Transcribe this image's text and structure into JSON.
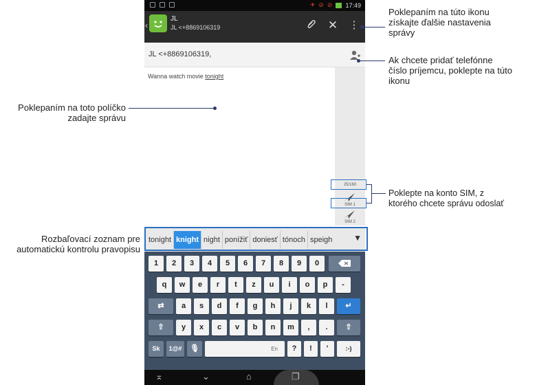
{
  "status_bar": {
    "time": "17:49"
  },
  "action_bar": {
    "name": "JL",
    "number": "JL <+8869106319",
    "attach_icon": "paperclip-icon",
    "discard_icon": "close-icon",
    "menu_icon": "overflow-menu-icon"
  },
  "recipient": {
    "value": "JL <+8869106319,"
  },
  "compose": {
    "text_before": "Wanna watch movie ",
    "text_underlined": "tonight"
  },
  "send_column": {
    "char_count": "25/160",
    "sim1_label": "SIM 1",
    "sim2_label": "SIM 2"
  },
  "suggestions": {
    "items": [
      "tonight",
      "knight",
      "night",
      "ponížiť",
      "doniesť",
      "tónoch",
      "speigh"
    ],
    "selected": "knight",
    "expand_glyph": "▼"
  },
  "keyboard": {
    "row1": [
      "1",
      "2",
      "3",
      "4",
      "5",
      "6",
      "7",
      "8",
      "9",
      "0"
    ],
    "row2": [
      "q",
      "w",
      "e",
      "r",
      "t",
      "z",
      "u",
      "i",
      "o",
      "p",
      "-"
    ],
    "row3": [
      "a",
      "s",
      "d",
      "f",
      "g",
      "h",
      "j",
      "k",
      "l"
    ],
    "row4": [
      "y",
      "x",
      "c",
      "v",
      "b",
      "n",
      "m",
      ",",
      "."
    ],
    "bottom": {
      "lang": "Sk",
      "symbols": "1@#",
      "space_label": "En",
      "q": "?",
      "ex": "!",
      "apos": "'",
      "smiley": ":-)"
    }
  },
  "annotations": {
    "menu": "Poklepaním na túto ikonu získajte ďalšie nastavenia správy",
    "recipient": "Ak chcete pridať telefónne číslo príjemcu, poklepte na túto ikonu",
    "compose": "Poklepaním na toto políčko zadajte správu",
    "sim": "Poklepte na konto SIM, z ktorého chcete správu odoslať",
    "spellcheck": "Rozbaľovací zoznam pre automatickú kontrolu pravopisu"
  },
  "colors": {
    "accent_blue": "#2e8ee4",
    "keyboard_bg": "#3f4f63",
    "action_bar": "#2b2b2b",
    "avatar_green": "#6fbd3a"
  }
}
